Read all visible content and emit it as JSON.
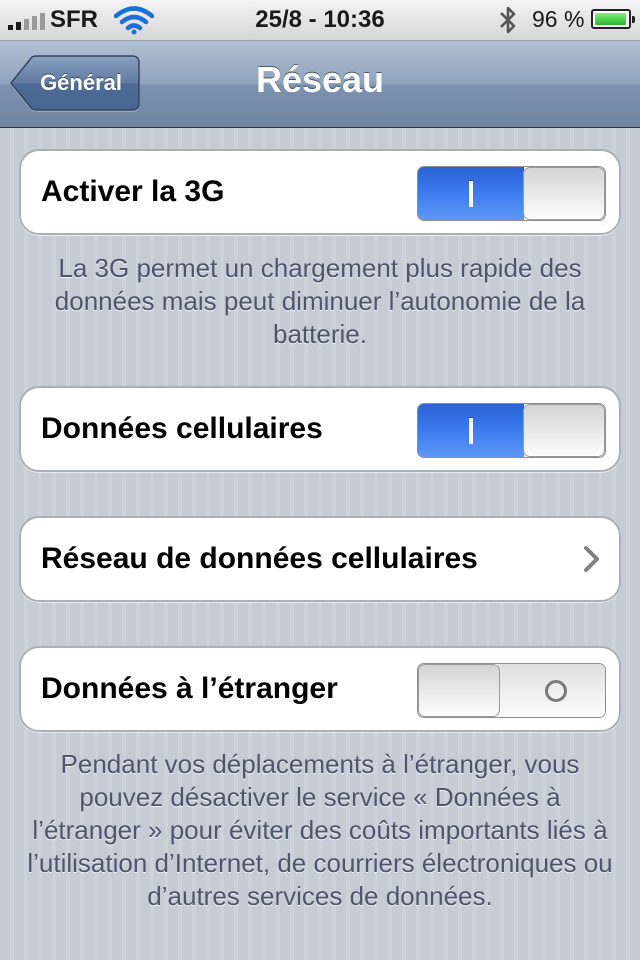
{
  "status_bar": {
    "carrier": "SFR",
    "time": "25/8 - 10:36",
    "battery_percent_label": "96 %",
    "battery_level": 0.96,
    "signal_bars": 2,
    "icons": {
      "signal": "signal-bars-icon",
      "wifi": "wifi-icon",
      "bluetooth": "bluetooth-icon",
      "battery": "battery-icon"
    }
  },
  "nav": {
    "back_label": "Général",
    "title": "Réseau"
  },
  "settings": {
    "enable_3g": {
      "label": "Activer la 3G",
      "state": "on"
    },
    "enable_3g_footer": "La 3G permet un chargement plus rapide des données mais peut diminuer l’autonomie de la batterie.",
    "cellular_data": {
      "label": "Données cellulaires",
      "state": "on"
    },
    "cellular_network": {
      "label": "Réseau de données cellulaires"
    },
    "roaming": {
      "label": "Données à l’étranger",
      "state": "off"
    },
    "roaming_footer": "Pendant vos déplacements à l’étranger, vous pouvez désactiver le service « Données à l’étranger » pour éviter des coûts importants liés à l’utilisation d’Internet, de courriers électroniques ou d’autres services de données."
  },
  "colors": {
    "switch_on": "#3b7cf0",
    "background": "#c5ccd4",
    "footer_text": "#4c566c"
  }
}
